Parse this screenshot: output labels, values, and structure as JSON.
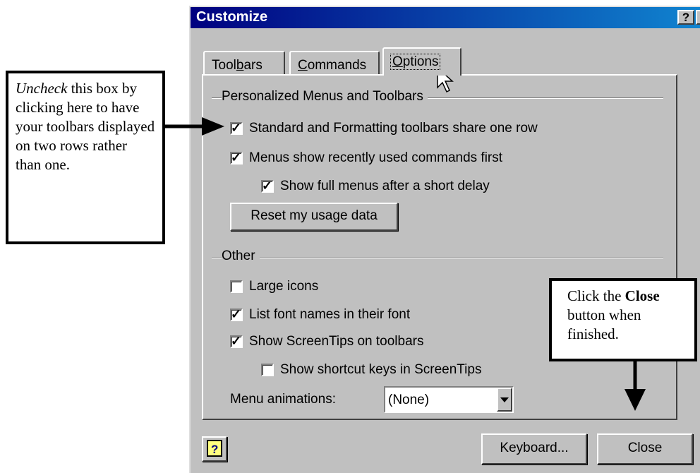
{
  "dialog": {
    "title": "Customize",
    "help_button": "?",
    "close_x": "×",
    "tabs": [
      {
        "label": "Toolbars",
        "accel": "b"
      },
      {
        "label": "Commands",
        "accel": "C"
      },
      {
        "label": "Options",
        "accel": "O"
      }
    ],
    "personalized_group": "Personalized Menus and Toolbars",
    "options": [
      {
        "label": "Standard and Formatting toolbars share one row",
        "checked": true
      },
      {
        "label": "Menus show recently used commands first",
        "checked": true
      },
      {
        "label": "Show full menus after a short delay",
        "checked": true
      }
    ],
    "reset_button": "Reset my usage data",
    "other_group": "Other",
    "other_options": [
      {
        "label": "Large icons",
        "checked": false
      },
      {
        "label": "List font names in their font",
        "checked": true
      },
      {
        "label": "Show ScreenTips on toolbars",
        "checked": true
      },
      {
        "label": "Show shortcut keys in ScreenTips",
        "checked": false
      }
    ],
    "menu_animations_label": "Menu animations:",
    "menu_animations_value": "(None)",
    "keyboard_button": "Keyboard...",
    "close_button": "Close"
  },
  "callouts": {
    "left_em": "Uncheck",
    "left_rest": " this box by clicking here to have your toolbars displayed on two rows rather than one.",
    "right_pre": "Click the ",
    "right_bold": "Close",
    "right_post": " button when finished."
  }
}
